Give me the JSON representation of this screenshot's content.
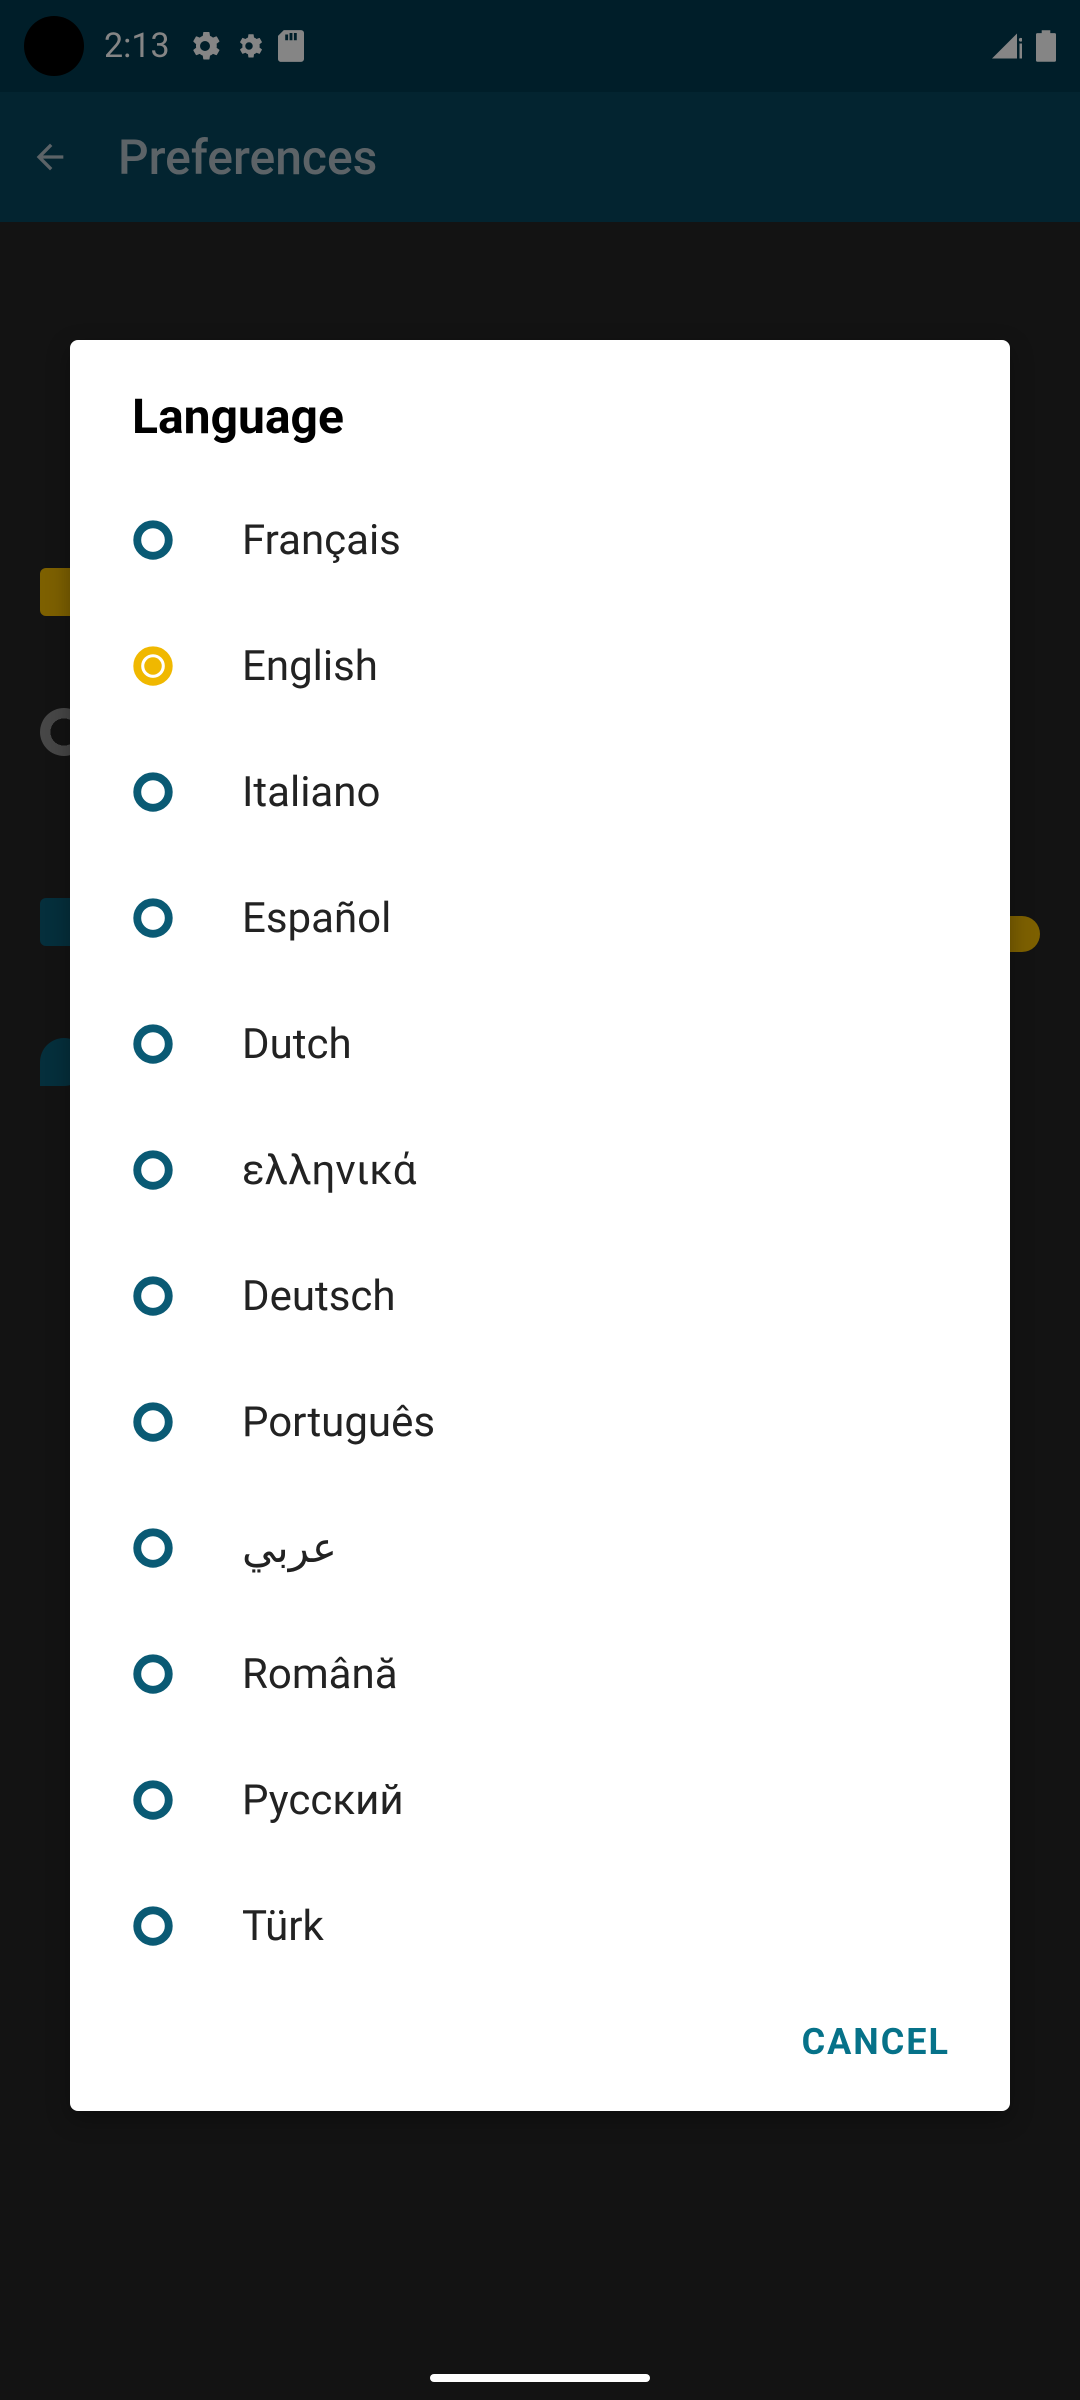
{
  "statusBar": {
    "time": "2:13"
  },
  "header": {
    "title": "Preferences"
  },
  "modal": {
    "title": "Language",
    "cancelLabel": "CANCEL",
    "options": [
      {
        "label": "Français",
        "selected": false
      },
      {
        "label": "English",
        "selected": true
      },
      {
        "label": "Italiano",
        "selected": false
      },
      {
        "label": "Español",
        "selected": false
      },
      {
        "label": "Dutch",
        "selected": false
      },
      {
        "label": "ελληνικά",
        "selected": false
      },
      {
        "label": "Deutsch",
        "selected": false
      },
      {
        "label": "Português",
        "selected": false
      },
      {
        "label": "عربي",
        "selected": false
      },
      {
        "label": "Română",
        "selected": false
      },
      {
        "label": "Русский",
        "selected": false
      },
      {
        "label": "Türk",
        "selected": false
      }
    ]
  }
}
